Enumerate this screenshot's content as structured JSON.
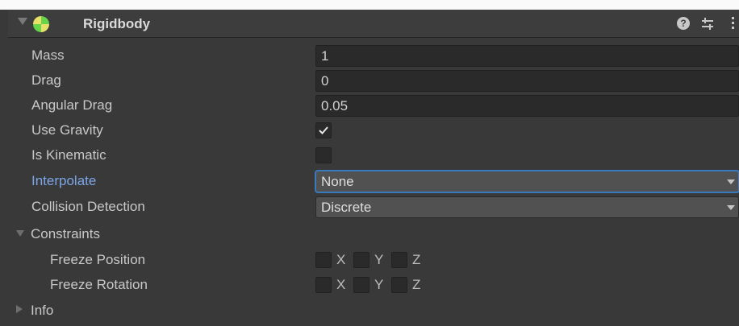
{
  "component": {
    "title": "Rigidbody",
    "help_glyph": "?",
    "icons": {
      "component": "rigidbody-icon",
      "help": "help-icon",
      "preset": "preset-icon",
      "menu": "kebab-menu-icon"
    }
  },
  "fields": {
    "mass": {
      "label": "Mass",
      "value": "1"
    },
    "drag": {
      "label": "Drag",
      "value": "0"
    },
    "angular_drag": {
      "label": "Angular Drag",
      "value": "0.05"
    },
    "use_gravity": {
      "label": "Use Gravity",
      "checked": true
    },
    "is_kinematic": {
      "label": "Is Kinematic",
      "checked": false
    },
    "interpolate": {
      "label": "Interpolate",
      "value": "None"
    },
    "collision_detection": {
      "label": "Collision Detection",
      "value": "Discrete"
    }
  },
  "constraints": {
    "label": "Constraints",
    "freeze_position": {
      "label": "Freeze Position",
      "axes": [
        "X",
        "Y",
        "Z"
      ]
    },
    "freeze_rotation": {
      "label": "Freeze Rotation",
      "axes": [
        "X",
        "Y",
        "Z"
      ]
    }
  },
  "info": {
    "label": "Info"
  },
  "colors": {
    "background": "#393939",
    "header": "#3d3d3d",
    "field": "#2a2a2a",
    "dropdown": "#515151",
    "focus": "#3a79bb",
    "label_highlight": "#7ca6e8"
  }
}
